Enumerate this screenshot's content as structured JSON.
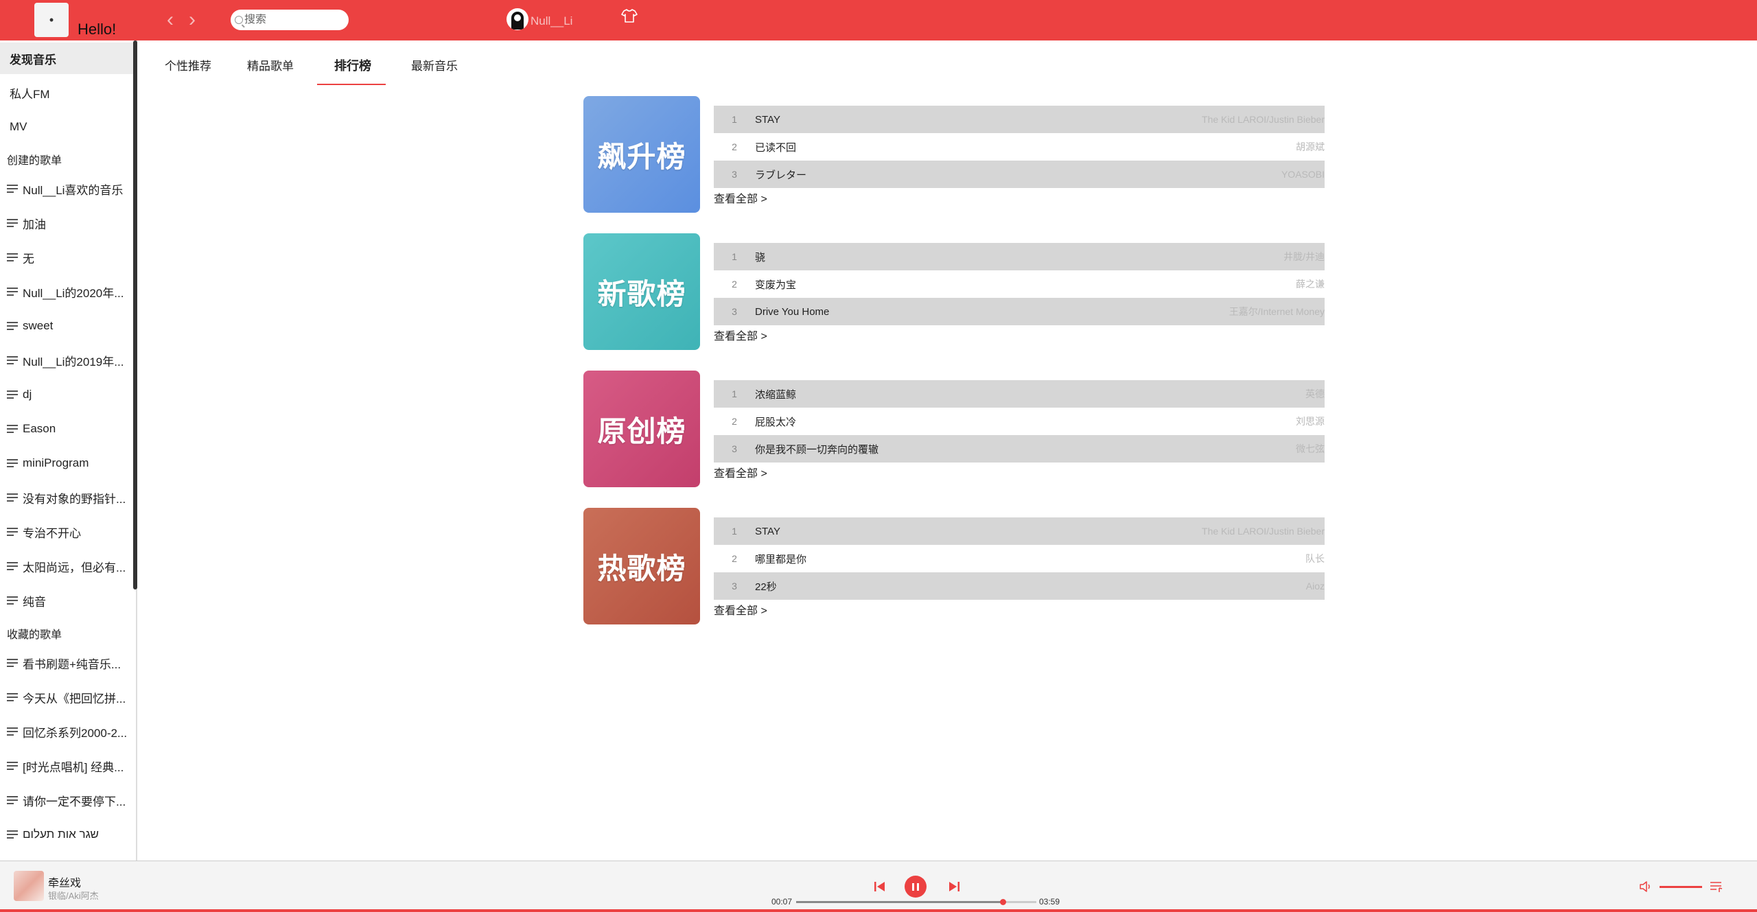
{
  "header": {
    "logo_glyph": "•",
    "greeting": "Hello!",
    "back_glyph": "‹",
    "forward_glyph": "›",
    "search_placeholder": "搜索",
    "user_name": "Null__Li",
    "skin_glyph": "👕",
    "accent": "#ec4141"
  },
  "sidebar": {
    "main": [
      {
        "label": "发现音乐",
        "active": true
      },
      {
        "label": "私人FM"
      },
      {
        "label": "MV"
      }
    ],
    "created_heading": "创建的歌单",
    "created": [
      "Null__Li喜欢的音乐",
      "加油",
      "无",
      "Null__Li的2020年...",
      "sweet",
      "Null__Li的2019年...",
      "dj",
      "Eason",
      "miniProgram",
      "没有对象的野指针...",
      "专治不开心",
      "太阳尚远，但必有...",
      "纯音"
    ],
    "collected_heading": "收藏的歌单",
    "collected": [
      "看书刷题+纯音乐...",
      "今天从《把回忆拼...",
      "回忆杀系列2000-2...",
      "[时光点唱机] 经典...",
      "请你一定不要停下...",
      "שגר אות תעלום"
    ]
  },
  "tabs": [
    {
      "label": "个性推荐"
    },
    {
      "label": "精品歌单"
    },
    {
      "label": "排行榜",
      "active": true
    },
    {
      "label": "最新音乐"
    }
  ],
  "ranks": [
    {
      "cover_text": "飙升榜",
      "colors": [
        "#7ea8e3",
        "#5b8fe0"
      ],
      "songs": [
        {
          "no": "1",
          "name": "STAY",
          "artist": "The Kid LAROI/Justin Bieber"
        },
        {
          "no": "2",
          "name": "已读不回",
          "artist": "胡源斌"
        },
        {
          "no": "3",
          "name": "ラブレター",
          "artist": "YOASOBI"
        }
      ],
      "see_all": "查看全部 >"
    },
    {
      "cover_text": "新歌榜",
      "colors": [
        "#5cc7c9",
        "#3fb3b6"
      ],
      "songs": [
        {
          "no": "1",
          "name": "骁",
          "artist": "井胧/井迪"
        },
        {
          "no": "2",
          "name": "变废为宝",
          "artist": "薛之谦"
        },
        {
          "no": "3",
          "name": "Drive You Home",
          "artist": "王嘉尔/Internet Money"
        }
      ],
      "see_all": "查看全部 >"
    },
    {
      "cover_text": "原创榜",
      "colors": [
        "#d75b85",
        "#c33f6c"
      ],
      "songs": [
        {
          "no": "1",
          "name": "浓缩蓝鲸",
          "artist": "英德"
        },
        {
          "no": "2",
          "name": "屁股太冷",
          "artist": "刘思源"
        },
        {
          "no": "3",
          "name": "你是我不顾一切奔向的覆辙",
          "artist": "微七弦"
        }
      ],
      "see_all": "查看全部 >"
    },
    {
      "cover_text": "热歌榜",
      "colors": [
        "#c96f58",
        "#b5513f"
      ],
      "songs": [
        {
          "no": "1",
          "name": "STAY",
          "artist": "The Kid LAROI/Justin Bieber"
        },
        {
          "no": "2",
          "name": "哪里都是你",
          "artist": "队长"
        },
        {
          "no": "3",
          "name": "22秒",
          "artist": "Aioz"
        }
      ],
      "see_all": "查看全部 >"
    }
  ],
  "player": {
    "title": "牵丝戏",
    "artist": "银临/Aki阿杰",
    "current_time": "00:07",
    "total_time": "03:59",
    "progress_fraction": 0.86,
    "volume_fraction": 1.0
  }
}
